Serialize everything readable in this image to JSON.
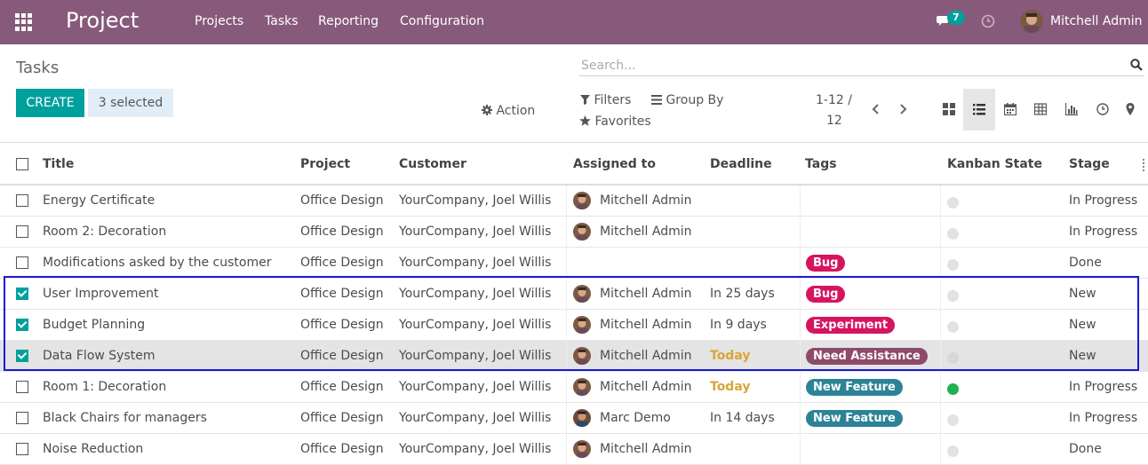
{
  "navbar": {
    "brand": "Project",
    "menu": [
      "Projects",
      "Tasks",
      "Reporting",
      "Configuration"
    ],
    "chat_count": "7",
    "user_name": "Mitchell Admin"
  },
  "control_panel": {
    "title": "Tasks",
    "create_label": "CREATE",
    "selected_label": "3 selected",
    "action_label": "Action",
    "search_placeholder": "Search...",
    "filters_label": "Filters",
    "group_by_label": "Group By",
    "favorites_label": "Favorites",
    "pager_value": "1-12 /",
    "pager_total": "12"
  },
  "table": {
    "headers": [
      "Title",
      "Project",
      "Customer",
      "Assigned to",
      "Deadline",
      "Tags",
      "Kanban State",
      "Stage"
    ],
    "rows": [
      {
        "title": "Energy Certificate",
        "project": "Office Design",
        "customer": "YourCompany, Joel Willis",
        "assigned": "Mitchell Admin",
        "deadline": "",
        "tag": "",
        "kanban": "grey",
        "stage": "In Progress",
        "checked": false
      },
      {
        "title": "Room 2: Decoration",
        "project": "Office Design",
        "customer": "YourCompany, Joel Willis",
        "assigned": "Mitchell Admin",
        "deadline": "",
        "tag": "",
        "kanban": "grey",
        "stage": "In Progress",
        "checked": false
      },
      {
        "title": "Modifications asked by the customer",
        "project": "Office Design",
        "customer": "YourCompany, Joel Willis",
        "assigned": "",
        "deadline": "",
        "tag": "Bug",
        "kanban": "grey",
        "stage": "Done",
        "checked": false
      },
      {
        "title": "User Improvement",
        "project": "Office Design",
        "customer": "YourCompany, Joel Willis",
        "assigned": "Mitchell Admin",
        "deadline": "In 25 days",
        "tag": "Bug",
        "kanban": "grey",
        "stage": "New",
        "checked": true
      },
      {
        "title": "Budget Planning",
        "project": "Office Design",
        "customer": "YourCompany, Joel Willis",
        "assigned": "Mitchell Admin",
        "deadline": "In 9 days",
        "tag": "Experiment",
        "kanban": "grey",
        "stage": "New",
        "checked": true
      },
      {
        "title": "Data Flow System",
        "project": "Office Design",
        "customer": "YourCompany, Joel Willis",
        "assigned": "Mitchell Admin",
        "deadline": "Today",
        "tag": "Need Assistance",
        "kanban": "grey",
        "stage": "New",
        "checked": true
      },
      {
        "title": "Room 1: Decoration",
        "project": "Office Design",
        "customer": "YourCompany, Joel Willis",
        "assigned": "Mitchell Admin",
        "deadline": "Today",
        "tag": "New Feature",
        "kanban": "green",
        "stage": "In Progress",
        "checked": false
      },
      {
        "title": "Black Chairs for managers",
        "project": "Office Design",
        "customer": "YourCompany, Joel Willis",
        "assigned": "Marc Demo",
        "deadline": "In 14 days",
        "tag": "New Feature",
        "kanban": "grey",
        "stage": "In Progress",
        "checked": false
      },
      {
        "title": "Noise Reduction",
        "project": "Office Design",
        "customer": "YourCompany, Joel Willis",
        "assigned": "Mitchell Admin",
        "deadline": "",
        "tag": "",
        "kanban": "grey",
        "stage": "Done",
        "checked": false
      }
    ]
  },
  "colors": {
    "navbar": "#875a7b",
    "primary": "#00a09d",
    "tag_bug": "#d6145f",
    "tag_experiment": "#d6145f",
    "tag_need_assistance": "#8e4a6a",
    "tag_new_feature": "#2c8397",
    "today": "#d9a53a",
    "kanban_green": "#21b14f",
    "highlight": "#1a1adb"
  }
}
